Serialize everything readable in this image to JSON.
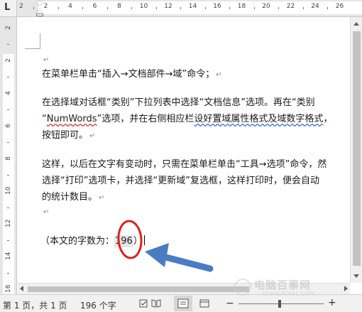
{
  "ruler": {
    "corner_label": "L",
    "top_ticks": [
      "2",
      "2",
      "4",
      "6",
      "8",
      "10",
      "12",
      "14",
      "16",
      "18",
      "20",
      "22",
      "24",
      "26"
    ],
    "left_ticks": [
      "2",
      "2",
      "4",
      "6",
      "8",
      "10",
      "12",
      "14",
      "16"
    ]
  },
  "document": {
    "paragraph_mark": "↵",
    "line1": "在菜单栏单击“插入→文档部件→域”命令；",
    "line2": "在选择域对话框“类别”下拉列表中选择“文档信息”选项。再在“类别",
    "line3_pre": "“",
    "line3_word": "NumWords",
    "line3_post": "”选项，并在右侧相应栏",
    "line3_blue": "设好置域属性格式及域数字格式",
    "line3_end": "，",
    "line4": "按钮即可。",
    "line5": "这样，以后在文字有变动时，只需在菜单栏单击“工具→选项”命令，然",
    "line6": "选择“打印”选项卡，并选择“更新域”复选框，这样打印时，便会自动",
    "line7": "的统计数目。",
    "count_prefix": "（本文的字数为：",
    "count_value": "196",
    "count_suffix": "）"
  },
  "statusbar": {
    "page_info": "第 1 页，共 1 页",
    "word_count": "196 个字",
    "zoom_minus": "−",
    "zoom_plus": "+",
    "zoom_level": 0.48
  },
  "watermark": {
    "text": "电脑百事网",
    "sub": "WWW.PC841.COM"
  },
  "colors": {
    "annotation_red": "#e02020",
    "arrow_blue": "#4a7cc4"
  }
}
